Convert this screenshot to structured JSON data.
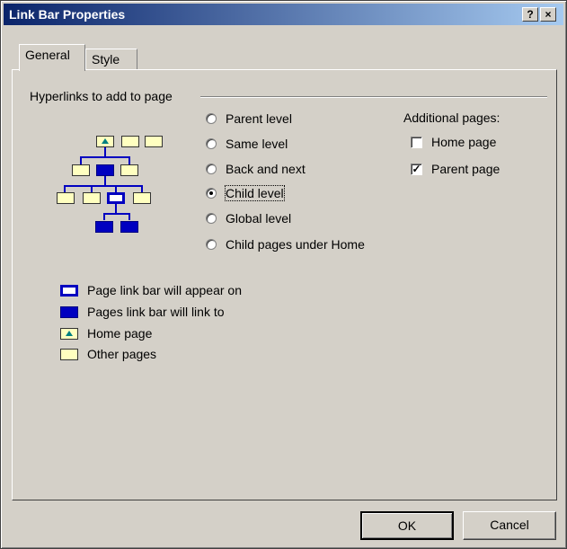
{
  "window": {
    "title": "Link Bar Properties",
    "help_glyph": "?",
    "close_glyph": "×"
  },
  "tabs": [
    {
      "label": "General"
    },
    {
      "label": "Style"
    }
  ],
  "hyperlinks": {
    "label": "Hyperlinks to add to page",
    "options": [
      {
        "label": "Parent level",
        "checked": false
      },
      {
        "label": "Same level",
        "checked": false
      },
      {
        "label": "Back and next",
        "checked": false
      },
      {
        "label": "Child level",
        "checked": true
      },
      {
        "label": "Global level",
        "checked": false
      },
      {
        "label": "Child pages under Home",
        "checked": false
      }
    ]
  },
  "additional": {
    "label": "Additional pages:",
    "home_page": {
      "label": "Home page",
      "checked": false
    },
    "parent_page": {
      "label": "Parent page",
      "checked": true
    }
  },
  "legend": [
    {
      "label": "Page link bar will appear on",
      "icon": "page-on-icon"
    },
    {
      "label": "Pages link bar will link to",
      "icon": "linked-page-icon"
    },
    {
      "label": "Home page",
      "icon": "home-page-icon"
    },
    {
      "label": "Other pages",
      "icon": "other-page-icon"
    }
  ],
  "buttons": {
    "ok": "OK",
    "cancel": "Cancel"
  },
  "colors": {
    "titlebar_start": "#0a246a",
    "link_blue": "#0000c0",
    "page_yellow": "#ffffc0",
    "face": "#d4d0c8"
  }
}
